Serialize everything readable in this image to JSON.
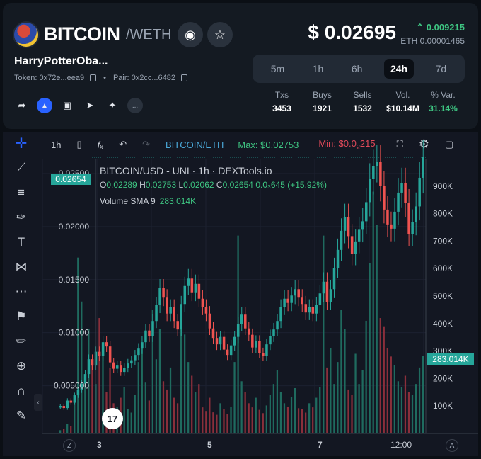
{
  "header": {
    "token_name": "BITCOIN",
    "pair_quote": "/WETH",
    "full_name": "HarryPotterOba...",
    "token_label": "Token: 0x72e...eea9",
    "pair_label": "Pair: 0x2cc...6482",
    "price": "$ 0.02695",
    "change": "0.009215",
    "change_color": "#3ec582",
    "eth_price": "ETH 0.00001465",
    "icons": [
      "binoculars-icon",
      "star-icon"
    ],
    "social_icons": [
      "share-icon",
      "dextools-icon",
      "monitor-icon",
      "telegram-icon",
      "twitter-icon",
      "more-icon"
    ],
    "more_label": "..."
  },
  "timeframes": {
    "options": [
      "5m",
      "1h",
      "6h",
      "24h",
      "7d"
    ],
    "selected": "24h"
  },
  "stats": [
    {
      "label": "Txs",
      "value": "3453"
    },
    {
      "label": "Buys",
      "value": "1921"
    },
    {
      "label": "Sells",
      "value": "1532"
    },
    {
      "label": "Vol.",
      "value": "$10.14M"
    },
    {
      "label": "% Var.",
      "value": "31.14%"
    }
  ],
  "chart_toolbar": {
    "interval": "1h",
    "symbol": "BITCOIN/ETH",
    "max_label": "Max: $0.02753",
    "min_label": "Min: $0.0",
    "min_sub": "2",
    "min_rest": "215",
    "icons": [
      "candles-icon",
      "indicators-icon",
      "undo-icon",
      "redo-icon",
      "fullscreen-icon",
      "settings-icon",
      "camera-icon"
    ]
  },
  "drawing_tools": [
    "crosshair-icon",
    "trendline-icon",
    "fib-icon",
    "brush-icon",
    "text-icon",
    "pattern-icon",
    "forecast-icon",
    "flag-icon",
    "ruler-icon",
    "zoom-icon",
    "magnet-icon",
    "lock-icon"
  ],
  "legend": {
    "title": "BITCOIN/USD - UNI · 1h · DEXTools.io",
    "o": "0.02289",
    "h": "0.02753",
    "l": "0.02062",
    "c": "0.02654",
    "change_text": "0.0₃645 (+15.92%)",
    "volume_label": "Volume SMA 9",
    "volume_value": "283.014K"
  },
  "tags": {
    "last_price": "0.02654",
    "last_volume": "283.014K"
  },
  "tv_logo": "17",
  "corner_labels": {
    "left": "Z",
    "right": "A"
  },
  "collapse": "‹",
  "chart_data": {
    "type": "candlestick",
    "price_axis": {
      "ticks": [
        "0.02500",
        "0.02000",
        "0.01500",
        "0.01000",
        "0.005000"
      ],
      "values": [
        0.025,
        0.02,
        0.015,
        0.01,
        0.005
      ],
      "ylim": [
        0.0005,
        0.0264
      ]
    },
    "volume_axis": {
      "ticks": [
        "900K",
        "800K",
        "700K",
        "600K",
        "500K",
        "400K",
        "300K",
        "200K",
        "100K"
      ],
      "values": [
        900000,
        800000,
        700000,
        600000,
        500000,
        400000,
        300000,
        200000,
        100000
      ]
    },
    "x_ticks": [
      "3",
      "5",
      "7",
      "12:00"
    ],
    "close": [
      0.0031,
      0.0029,
      0.0036,
      0.0034,
      0.0041,
      0.0046,
      0.0052,
      0.0061,
      0.0075,
      0.0069,
      0.0082,
      0.0078,
      0.0091,
      0.0087,
      0.0072,
      0.0066,
      0.0069,
      0.0063,
      0.0067,
      0.0071,
      0.0074,
      0.0079,
      0.0085,
      0.0091,
      0.0102,
      0.0097,
      0.0111,
      0.0126,
      0.0142,
      0.0133,
      0.0118,
      0.0124,
      0.0111,
      0.0103,
      0.0127,
      0.0144,
      0.0151,
      0.0138,
      0.0146,
      0.0132,
      0.0124,
      0.0118,
      0.0104,
      0.0095,
      0.0089,
      0.0096,
      0.0084,
      0.0079,
      0.0088,
      0.0096,
      0.0108,
      0.0117,
      0.0104,
      0.0098,
      0.0086,
      0.0092,
      0.0081,
      0.0078,
      0.0089,
      0.0097,
      0.0103,
      0.0111,
      0.0124,
      0.0132,
      0.0128,
      0.0135,
      0.0141,
      0.0133,
      0.0127,
      0.0119,
      0.0124,
      0.0118,
      0.0126,
      0.0137,
      0.0148,
      0.0129,
      0.0141,
      0.0161,
      0.0178,
      0.0196,
      0.0209,
      0.0191,
      0.0174,
      0.0186,
      0.0197,
      0.0205,
      0.0223,
      0.0245,
      0.0257,
      0.0261,
      0.0238,
      0.0216,
      0.0202,
      0.0198,
      0.0214,
      0.0232,
      0.0241,
      0.0222,
      0.0193,
      0.0204,
      0.0219,
      0.0246,
      0.02654
    ],
    "volume": [
      12000,
      18000,
      35000,
      28000,
      120000,
      640000,
      480000,
      210000,
      380000,
      260000,
      180000,
      420000,
      290000,
      150000,
      240000,
      110000,
      95000,
      130000,
      170000,
      88000,
      76000,
      140000,
      260000,
      310000,
      185000,
      120000,
      450000,
      270000,
      380000,
      190000,
      160000,
      240000,
      130000,
      110000,
      420000,
      360000,
      260000,
      210000,
      150000,
      180000,
      95000,
      82000,
      130000,
      77000,
      68000,
      110000,
      90000,
      72000,
      98000,
      260000,
      720000,
      190000,
      150000,
      110000,
      95000,
      130000,
      86000,
      74000,
      102000,
      140000,
      180000,
      230000,
      150000,
      110000,
      98000,
      132000,
      165000,
      92000,
      88000,
      76000,
      110000,
      95000,
      130000,
      170000,
      720000,
      240000,
      310000,
      180000,
      260000,
      450000,
      380000,
      160000,
      140000,
      290000,
      180000,
      230000,
      410000,
      620000,
      880000,
      760000,
      420000,
      390000,
      310000,
      280000,
      250000,
      190000,
      170000,
      210000,
      150000,
      140000,
      180000,
      240000,
      283014
    ]
  }
}
